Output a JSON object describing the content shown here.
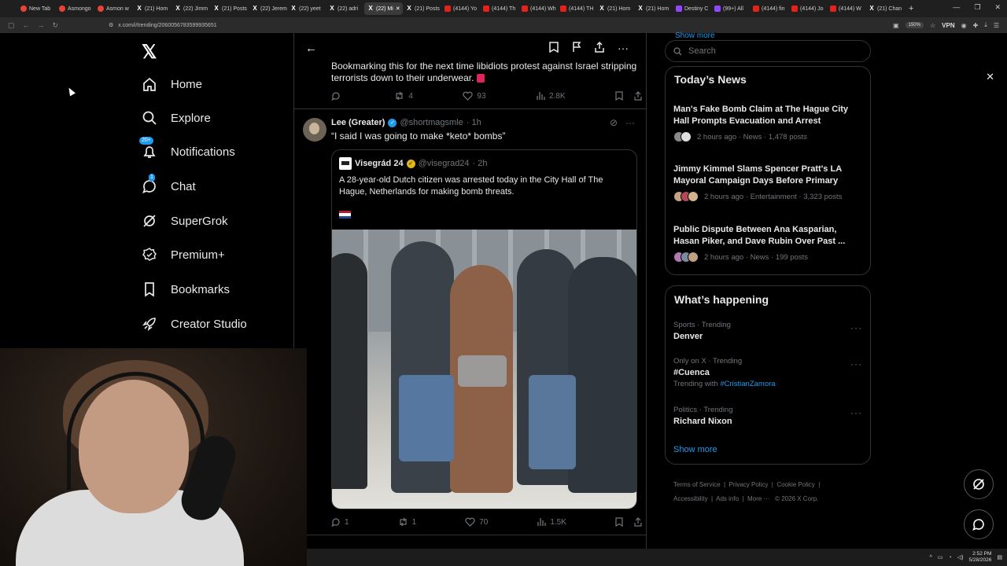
{
  "browser": {
    "tabs": [
      {
        "label": "New Tab",
        "icon": "g"
      },
      {
        "label": "Asmongo",
        "icon": "g"
      },
      {
        "label": "Asmon w",
        "icon": "g"
      },
      {
        "label": "(21) Hom",
        "icon": "x"
      },
      {
        "label": "(22) Jimm",
        "icon": "x"
      },
      {
        "label": "(21) Posts",
        "icon": "x"
      },
      {
        "label": "(22) Jerem",
        "icon": "x"
      },
      {
        "label": "(22) yeet",
        "icon": "x"
      },
      {
        "label": "(22) adri",
        "icon": "x"
      },
      {
        "label": "(22) Mi",
        "icon": "x",
        "active": true
      },
      {
        "label": "(21) Posts",
        "icon": "x"
      },
      {
        "label": "(4144) Yo",
        "icon": "yt"
      },
      {
        "label": "(4144) Th",
        "icon": "yt"
      },
      {
        "label": "(4144) Wh",
        "icon": "yt"
      },
      {
        "label": "(4144) TH",
        "icon": "yt"
      },
      {
        "label": "(21) Hom",
        "icon": "x"
      },
      {
        "label": "(21) Hom",
        "icon": "x"
      },
      {
        "label": "Destiny C",
        "icon": "tw"
      },
      {
        "label": "(99+) All",
        "icon": "tw"
      },
      {
        "label": "(4144) fin",
        "icon": "yt"
      },
      {
        "label": "(4144) Jo",
        "icon": "yt"
      },
      {
        "label": "(4144) W",
        "icon": "yt"
      },
      {
        "label": "(21) Chan",
        "icon": "x"
      }
    ],
    "url": "x.com/i/trending/2060056783599935651",
    "zoom": "150%",
    "vpn": "VPN"
  },
  "sidebar": {
    "items": [
      {
        "label": "Home",
        "icon": "home-icon"
      },
      {
        "label": "Explore",
        "icon": "search-icon"
      },
      {
        "label": "Notifications",
        "icon": "bell-icon",
        "badge": "20+"
      },
      {
        "label": "Chat",
        "icon": "chat-icon",
        "badge": "1"
      },
      {
        "label": "SuperGrok",
        "icon": "grok-icon"
      },
      {
        "label": "Premium+",
        "icon": "premium-icon"
      },
      {
        "label": "Bookmarks",
        "icon": "bookmark-icon"
      },
      {
        "label": "Creator Studio",
        "icon": "rocket-icon"
      }
    ]
  },
  "feed": {
    "previous_post": {
      "text": "Bookmarking this for the next time libidiots protest against Israel stripping terrorists down to their underwear.",
      "replies": "",
      "reposts": "4",
      "likes": "93",
      "views": "2.8K"
    },
    "post": {
      "author_name": "Lee (Greater)",
      "handle": "@shortmagsmle",
      "time": "· 1h",
      "text": "“I said I was going to make *keto* bombs”",
      "quote": {
        "author_name": "Visegrád 24",
        "handle": "@visegrad24",
        "time": "· 2h",
        "text": "A 28-year-old Dutch citizen was arrested today in the City Hall of The Hague, Netherlands for making bomb threats."
      },
      "replies": "1",
      "reposts": "1",
      "likes": "70",
      "views": "1.5K"
    }
  },
  "right": {
    "top_show_more": "Show more",
    "search_placeholder": "Search",
    "todays_news": {
      "title": "Today’s News",
      "items": [
        {
          "headline": "Man's Fake Bomb Claim at The Hague City Hall Prompts Evacuation and Arrest",
          "meta": "2 hours ago · News · 1,478 posts"
        },
        {
          "headline": "Jimmy Kimmel Slams Spencer Pratt's LA Mayoral Campaign Days Before Primary",
          "meta": "2 hours ago · Entertainment · 3,323 posts"
        },
        {
          "headline": "Public Dispute Between Ana Kasparian, Hasan Piker, and Dave Rubin Over Past ...",
          "meta": "2 hours ago · News · 199 posts"
        }
      ]
    },
    "happening": {
      "title": "What’s happening",
      "items": [
        {
          "category": "Sports · Trending",
          "topic": "Denver",
          "with_label": "",
          "with_tag": ""
        },
        {
          "category": "Only on X · Trending",
          "topic": "#Cuenca",
          "with_label": "Trending with",
          "with_tag": "#CristianZamora"
        },
        {
          "category": "Politics · Trending",
          "topic": "Richard Nixon",
          "with_label": "",
          "with_tag": ""
        }
      ],
      "show_more": "Show more"
    },
    "footer": {
      "terms": "Terms of Service",
      "privacy": "Privacy Policy",
      "cookie": "Cookie Policy",
      "accessibility": "Accessibility",
      "ads": "Ads info",
      "more": "More ···",
      "copyright": "© 2026 X Corp."
    }
  },
  "taskbar": {
    "time": "2:52 PM",
    "date": "5/28/2026"
  },
  "colors": {
    "accent": "#1d9bf0",
    "background": "#000000",
    "border": "#2f3336",
    "muted": "#71767b"
  }
}
